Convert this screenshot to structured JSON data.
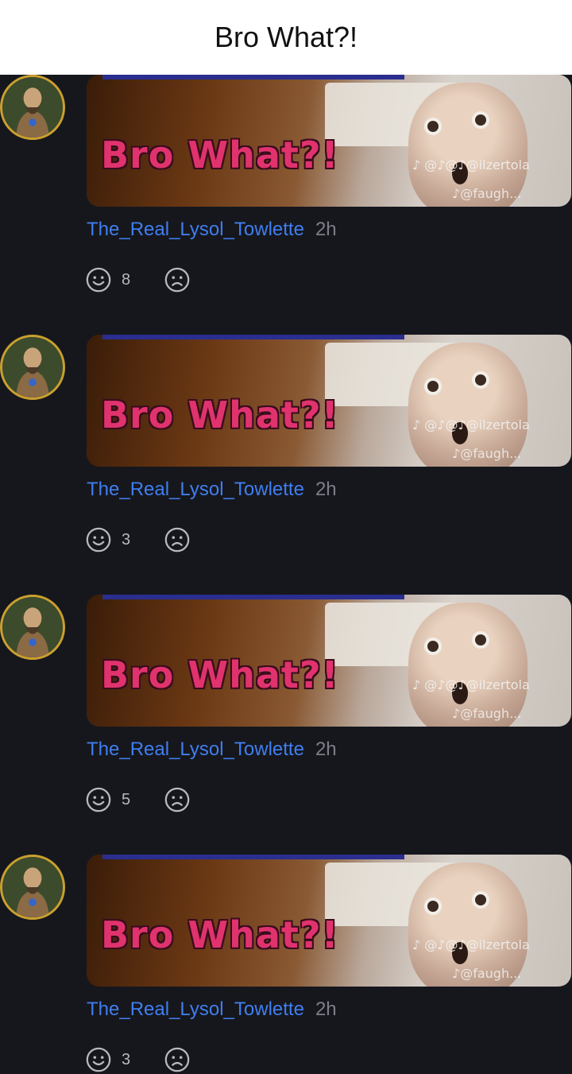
{
  "header": {
    "title": "Bro What?!"
  },
  "meme": {
    "caption": "Bro What?!",
    "watermark_1": "♪ @♪@♪@ilzertola",
    "watermark_2": "♪@faugh..."
  },
  "colors": {
    "background": "#16171d",
    "username": "#3f7ef0",
    "meme_caption": "#e0336d",
    "avatar_ring": "#caa02e"
  },
  "icons": {
    "avatar": "avatar-icon",
    "happy": "smile-icon",
    "sad": "frown-icon"
  },
  "comments": [
    {
      "username": "The_Real_Lysol_Towlette",
      "time": "2h",
      "happy_count": "8"
    },
    {
      "username": "The_Real_Lysol_Towlette",
      "time": "2h",
      "happy_count": "3"
    },
    {
      "username": "The_Real_Lysol_Towlette",
      "time": "2h",
      "happy_count": "5"
    },
    {
      "username": "The_Real_Lysol_Towlette",
      "time": "2h",
      "happy_count": "3"
    }
  ]
}
